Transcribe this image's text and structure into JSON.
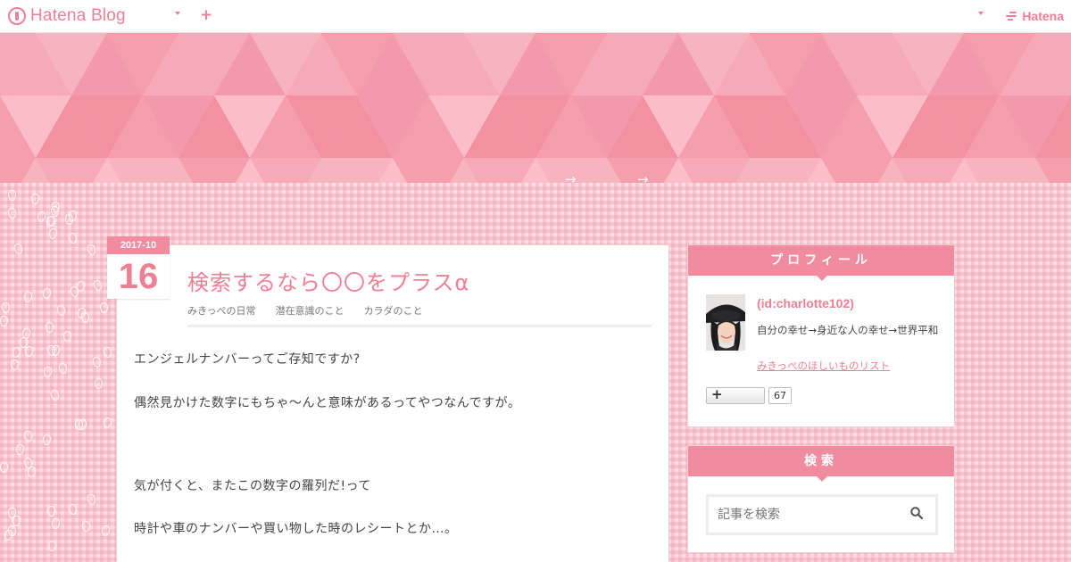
{
  "topbar": {
    "brand": "Hatena Blog",
    "hatena": "Hatena",
    "icons": [
      "hatena-blog-logo-icon",
      "chevron-down-icon",
      "plus-icon",
      "hatena-logo-icon"
    ]
  },
  "header": {
    "arrow1": "→",
    "arrow2": "→"
  },
  "entry": {
    "date_ym": "2017-10",
    "date_day": "16",
    "title": "検索するなら〇〇をプラスα",
    "categories": [
      "みきっぺの日常",
      "潜在意識のこと",
      "カラダのこと"
    ],
    "body": [
      "エンジェルナンバーってご存知ですか?",
      "偶然見かけた数字にもちゃ〜んと意味があるってやつなんですが。",
      "気が付くと、またこの数字の羅列だ!って",
      "時計や車のナンバーや買い物した時のレシートとか…。"
    ]
  },
  "sidebar": {
    "profile": {
      "heading": "プロフィール",
      "id": "(id:charlotte102)",
      "description": "自分の幸せ→身近な人の幸せ→世界平和",
      "wishlist": "みきっぺのほしいものリスト",
      "follow_icon": "plus-icon",
      "reader_count": "67"
    },
    "search": {
      "heading": "検索",
      "placeholder": "記事を検索",
      "icon": "search-icon"
    }
  },
  "colors": {
    "accent": "#ef7f93",
    "header_bg": "#f5a4b2",
    "check_bg": "#fbdde3"
  }
}
